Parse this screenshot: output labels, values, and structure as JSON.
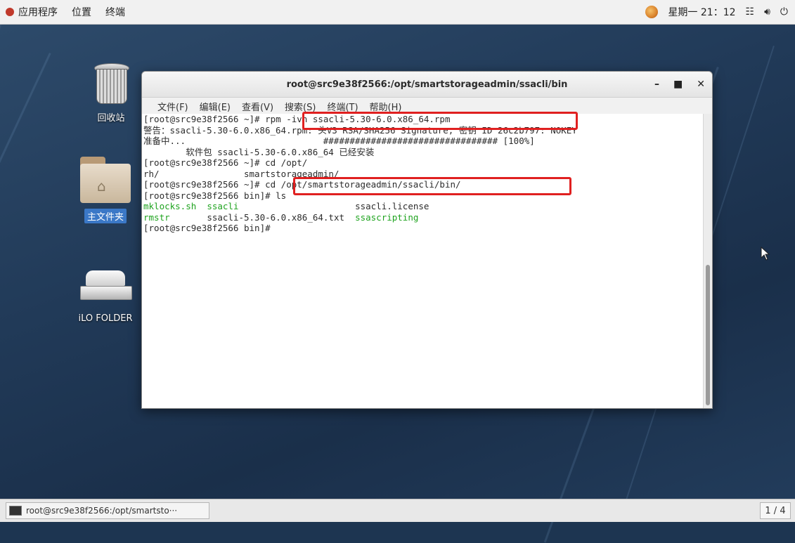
{
  "top_panel": {
    "apps_label": "应用程序",
    "places_label": "位置",
    "terminal_label": "终端",
    "clock": "星期一 21：12"
  },
  "desktop": {
    "icons": [
      {
        "label": "回收站",
        "icon": "trash-icon"
      },
      {
        "label": "主文件夹",
        "icon": "home-folder-icon"
      },
      {
        "label": "iLO FOLDER",
        "icon": "drive-icon"
      }
    ]
  },
  "terminal": {
    "title": "root@src9e38f2566:/opt/smartstorageadmin/ssacli/bin",
    "menu": [
      "文件(F)",
      "编辑(E)",
      "查看(V)",
      "搜索(S)",
      "终端(T)",
      "帮助(H)"
    ],
    "lines": [
      "[root@src9e38f2566 ~]# rpm -ivh ssacli-5.30-6.0.x86_64.rpm",
      "警告：ssacli-5.30-6.0.x86_64.rpm: 头V3 RSA/SHA256 Signature, 密钥 ID 26c2b797: NOKEY",
      "准备中...                          ################################# [100%]",
      "        软件包 ssacli-5.30-6.0.x86_64 已经安装",
      "[root@src9e38f2566 ~]# cd /opt/",
      "rh/                smartstorageadmin/",
      "[root@src9e38f2566 ~]# cd /opt/smartstorageadmin/ssacli/bin/",
      "[root@src9e38f2566 bin]# ls"
    ],
    "ls_row1": {
      "a": "mklocks.sh",
      "b": "ssacli",
      "c": "ssacli.license"
    },
    "ls_row2": {
      "a": "rmstr",
      "b": "ssacli-5.30-6.0.x86_64.txt",
      "c": "ssascripting"
    },
    "prompt_line": "[root@src9e38f2566 bin]#"
  },
  "taskbar": {
    "window_label": "root@src9e38f2566:/opt/smartsto···",
    "pager": "1 / 4"
  },
  "colors": {
    "highlight": "#e02020",
    "ls_green": "#1fa31f"
  }
}
